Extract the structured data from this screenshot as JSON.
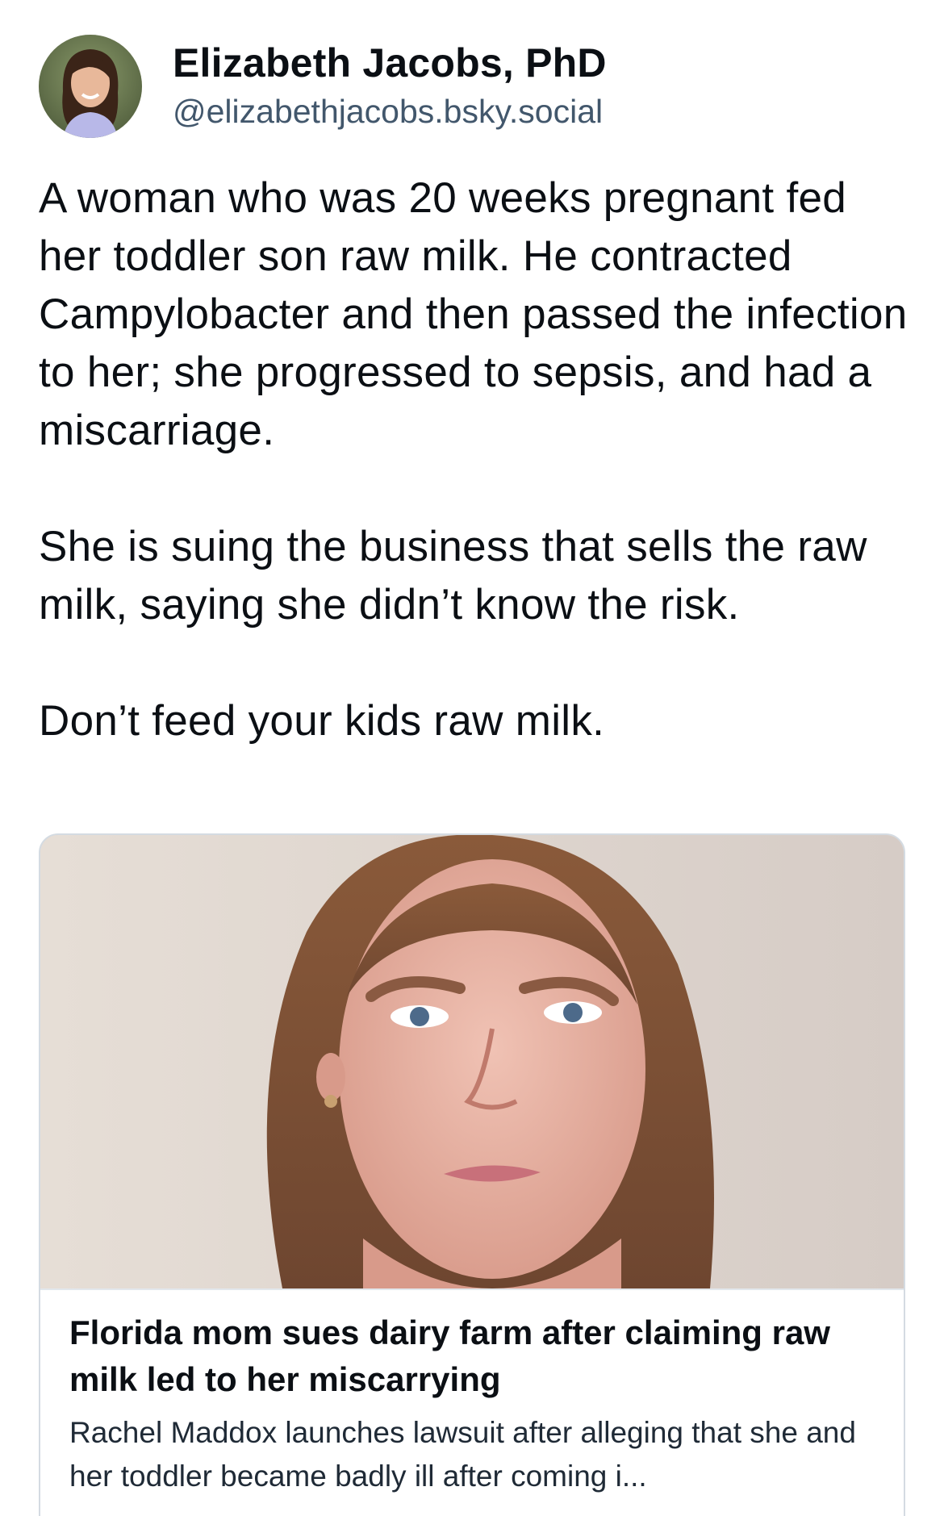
{
  "author": {
    "display_name": "Elizabeth Jacobs, PhD",
    "handle": "@elizabethjacobs.bsky.social",
    "avatar_icon": "profile-photo"
  },
  "post": {
    "paragraphs": [
      "A woman who was 20 weeks pregnant fed her toddler son raw milk. He contracted Campylobacter and then passed the infection to her; she progressed to sepsis, and had a miscarriage.",
      "She is suing the business that sells the raw milk, saying she didn’t know the risk.",
      "Don’t feed your kids raw milk."
    ]
  },
  "link_card": {
    "thumbnail": "news-photo",
    "title": "Florida mom sues dairy farm after claiming raw milk led to her miscarrying",
    "description": "Rachel Maddox launches lawsuit after alleging that she and her toddler became badly ill after coming i..."
  },
  "colors": {
    "text": "#0b0f14",
    "handle": "#42576c",
    "card_border": "#d4dbe2"
  }
}
